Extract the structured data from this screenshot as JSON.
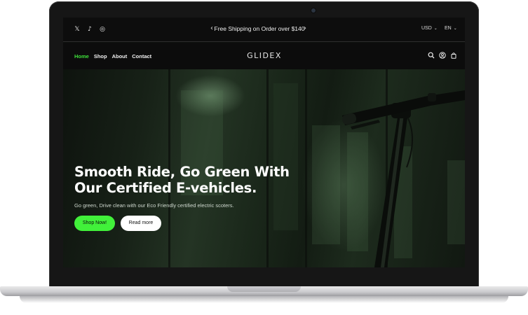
{
  "announcement": {
    "socials": [
      {
        "icon": "x-icon",
        "glyph": "𝕏"
      },
      {
        "icon": "tiktok-icon",
        "glyph": "♪"
      },
      {
        "icon": "instagram-icon",
        "glyph": "◎"
      }
    ],
    "prev_icon": "chevron-left-icon",
    "next_icon": "chevron-right-icon",
    "message": "Free Shipping on Order over $140",
    "currency": "USD",
    "language": "EN"
  },
  "nav": {
    "links": [
      {
        "label": "Home",
        "active": true
      },
      {
        "label": "Shop",
        "active": false
      },
      {
        "label": "About",
        "active": false
      },
      {
        "label": "Contact",
        "active": false
      }
    ],
    "logo": "GLIDEX",
    "icons": [
      "search-icon",
      "account-icon",
      "cart-icon"
    ]
  },
  "hero": {
    "headline_line1": "Smooth Ride, Go Green With",
    "headline_line2": "Our Certified E-vehicles.",
    "subtext": "Go green, Drive clean with our Eco Friendly certified electric scoters.",
    "primary_button": "Shop Now!",
    "secondary_button": "Read more"
  },
  "colors": {
    "accent": "#41f13a",
    "active_link": "#3ee03a",
    "bar_background": "#0d0d0d"
  }
}
